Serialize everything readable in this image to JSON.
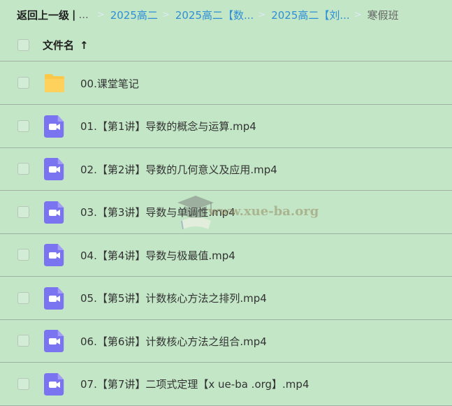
{
  "breadcrumb": {
    "back_label": "返回上一级",
    "separator": "|",
    "ellipsis": "...",
    "chevron": ">",
    "links": [
      "2025高二",
      "2025高二【数...",
      "2025高二【刘..."
    ],
    "current": "寒假班"
  },
  "header": {
    "title": "文件名",
    "sort_arrow": "↑"
  },
  "files": [
    {
      "name": "00.课堂笔记",
      "type": "folder"
    },
    {
      "name": "01.【第1讲】导数的概念与运算.mp4",
      "type": "video"
    },
    {
      "name": "02.【第2讲】导数的几何意义及应用.mp4",
      "type": "video"
    },
    {
      "name": "03.【第3讲】导数与单调性.mp4",
      "type": "video"
    },
    {
      "name": "04.【第4讲】导数与极最值.mp4",
      "type": "video"
    },
    {
      "name": "05.【第5讲】计数核心方法之排列.mp4",
      "type": "video"
    },
    {
      "name": "06.【第6讲】计数核心方法之组合.mp4",
      "type": "video"
    },
    {
      "name": "07.【第7讲】二项式定理【x ue-ba .org】.mp4",
      "type": "video"
    }
  ],
  "watermark": {
    "text": "www.xue-ba.org"
  },
  "colors": {
    "background": "#c3e6c6",
    "link": "#2e8fd6",
    "folder": "#fcc84a",
    "video": "#7b74f0"
  }
}
